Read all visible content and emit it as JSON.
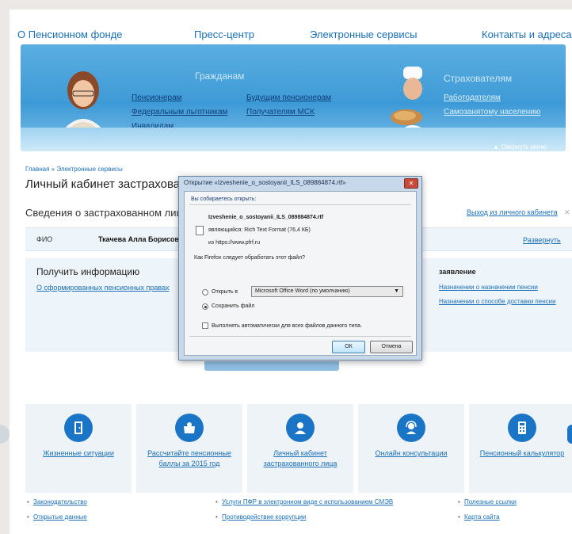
{
  "topnav": {
    "about": "О Пенсионном фонде",
    "press": "Пресс-центр",
    "eservices": "Электронные сервисы",
    "contacts": "Контакты и адреса"
  },
  "banner": {
    "citizens_title": "Гражданам",
    "citizens_links": [
      "Пенсионерам",
      "Будущим пенсионерам",
      "Федеральным льготникам",
      "Получателям МСК",
      "Инвалидам"
    ],
    "insurers_title": "Страхователям",
    "insurers_links": [
      "Работодателям",
      "Самозанятому населению"
    ],
    "minimize": "▲ Свернуть меню"
  },
  "breadcrumb": "Главная » Электронные сервисы",
  "page_title": "Личный кабинет застрахованного лица",
  "section_title": "Сведения о застрахованном лице",
  "exit_link": "Выход из личного кабинета",
  "fio": {
    "label": "ФИО",
    "value": "Ткачева Алла Борисовна",
    "expand": "Развернуть"
  },
  "info": {
    "title": "Получить информацию",
    "link": "О сформированных пенсионных правах",
    "app_title": "заявление",
    "app_link1": "Назначении о назначении пенсии",
    "app_link2": "Назначении о способе доставки пенсии"
  },
  "dialog": {
    "title": "Открытие «Izveshenie_o_sostoyanii_ILS_089884874.rtf»",
    "opening_label": "Вы собираетесь открыть:",
    "file_name": "Izveshenie_o_sostoyanii_ILS_089884874.rtf",
    "file_type": "являющийся: Rich Text Format (76,4 КБ)",
    "file_from": "из https://www.pfrf.ru",
    "question": "Как Firefox следует обработать этот файл?",
    "open_with_label": "Открыть в",
    "open_with_value": "Microsoft Office Word (по умолчанию)",
    "save_label": "Сохранить файл",
    "auto_label": "Выполнять автоматически для всех файлов данного типа.",
    "ok": "ОК",
    "cancel": "Отмена"
  },
  "services": [
    {
      "label": "Жизненные ситуации",
      "icon": "door-icon"
    },
    {
      "label": "Рассчитайте пенсионные баллы за 2015 год",
      "icon": "wallet-icon"
    },
    {
      "label": "Личный кабинет застрахованного лица",
      "icon": "user-icon"
    },
    {
      "label": "Онлайн консультации",
      "icon": "operator-icon"
    },
    {
      "label": "Пенсионный калькулятор",
      "icon": "calculator-icon"
    }
  ],
  "footer": {
    "col1": [
      "Законодательство",
      "Открытые данные"
    ],
    "col2": [
      "Услуги ПФР в электронном виде с использованием СМЭВ",
      "Противодействие коррупции"
    ],
    "col3": [
      "Полезные ссылки",
      "Карта сайта"
    ]
  },
  "colors": {
    "accent": "#1a6fb8",
    "banner": "#3e9ad6",
    "icon_circle": "#1a75c6"
  }
}
